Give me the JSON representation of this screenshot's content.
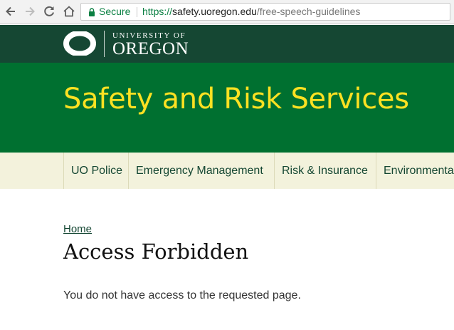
{
  "browser": {
    "security_label": "Secure",
    "url_scheme": "https://",
    "url_host": "safety.uoregon.edu",
    "url_path": "/free-speech-guidelines",
    "icons": [
      "back-arrow-icon",
      "forward-arrow-icon",
      "reload-icon",
      "home-icon",
      "lock-icon"
    ]
  },
  "uo_header": {
    "logo_top": "UNIVERSITY OF",
    "logo_bottom": "OREGON",
    "colors": {
      "background": "#154733",
      "text": "#ffffff"
    }
  },
  "banner": {
    "title": "Safety and Risk Services",
    "colors": {
      "background": "#007030",
      "title": "#fce122"
    }
  },
  "menu": {
    "items": [
      {
        "label": "UO Police"
      },
      {
        "label": "Emergency Management"
      },
      {
        "label": "Risk & Insurance"
      },
      {
        "label": "Environmenta"
      }
    ],
    "colors": {
      "background": "#f3f2dc",
      "text": "#154733"
    }
  },
  "content": {
    "breadcrumb": "Home",
    "title": "Access Forbidden",
    "message": "You do not have access to the requested page."
  }
}
